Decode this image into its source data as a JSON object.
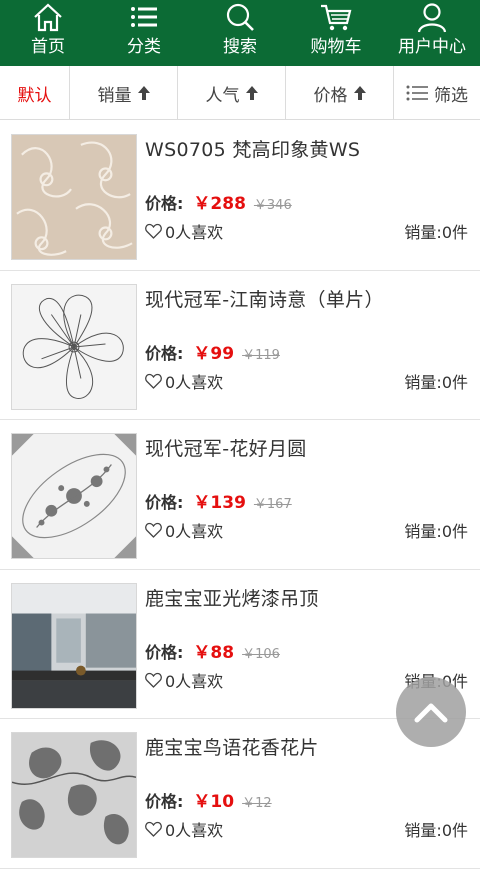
{
  "nav": [
    {
      "label": "首页",
      "icon": "home-icon"
    },
    {
      "label": "分类",
      "icon": "category-list-icon"
    },
    {
      "label": "搜索",
      "icon": "search-icon"
    },
    {
      "label": "购物车",
      "icon": "cart-icon"
    },
    {
      "label": "用户中心",
      "icon": "user-icon"
    }
  ],
  "sort": {
    "default": "默认",
    "sales": "销量",
    "popularity": "人气",
    "price": "价格",
    "filter": "筛选"
  },
  "labels": {
    "price": "价格:",
    "sales": "销量:"
  },
  "products": [
    {
      "title": "WS0705 梵高印象黄WS",
      "price": "￥288",
      "old_price": "￥346",
      "likes": "0人喜欢",
      "sales": "0件"
    },
    {
      "title": "现代冠军-江南诗意（单片）",
      "price": "￥99",
      "old_price": "￥119",
      "likes": "0人喜欢",
      "sales": "0件"
    },
    {
      "title": "现代冠军-花好月圆",
      "price": "￥139",
      "old_price": "￥167",
      "likes": "0人喜欢",
      "sales": "0件"
    },
    {
      "title": "鹿宝宝亚光烤漆吊顶",
      "price": "￥88",
      "old_price": "￥106",
      "likes": "0人喜欢",
      "sales": "0件"
    },
    {
      "title": "鹿宝宝鸟语花香花片",
      "price": "￥10",
      "old_price": "￥12",
      "likes": "0人喜欢",
      "sales": "0件"
    }
  ],
  "colors": {
    "nav_bg": "#0c6b35",
    "accent_red": "#e50f0f"
  }
}
